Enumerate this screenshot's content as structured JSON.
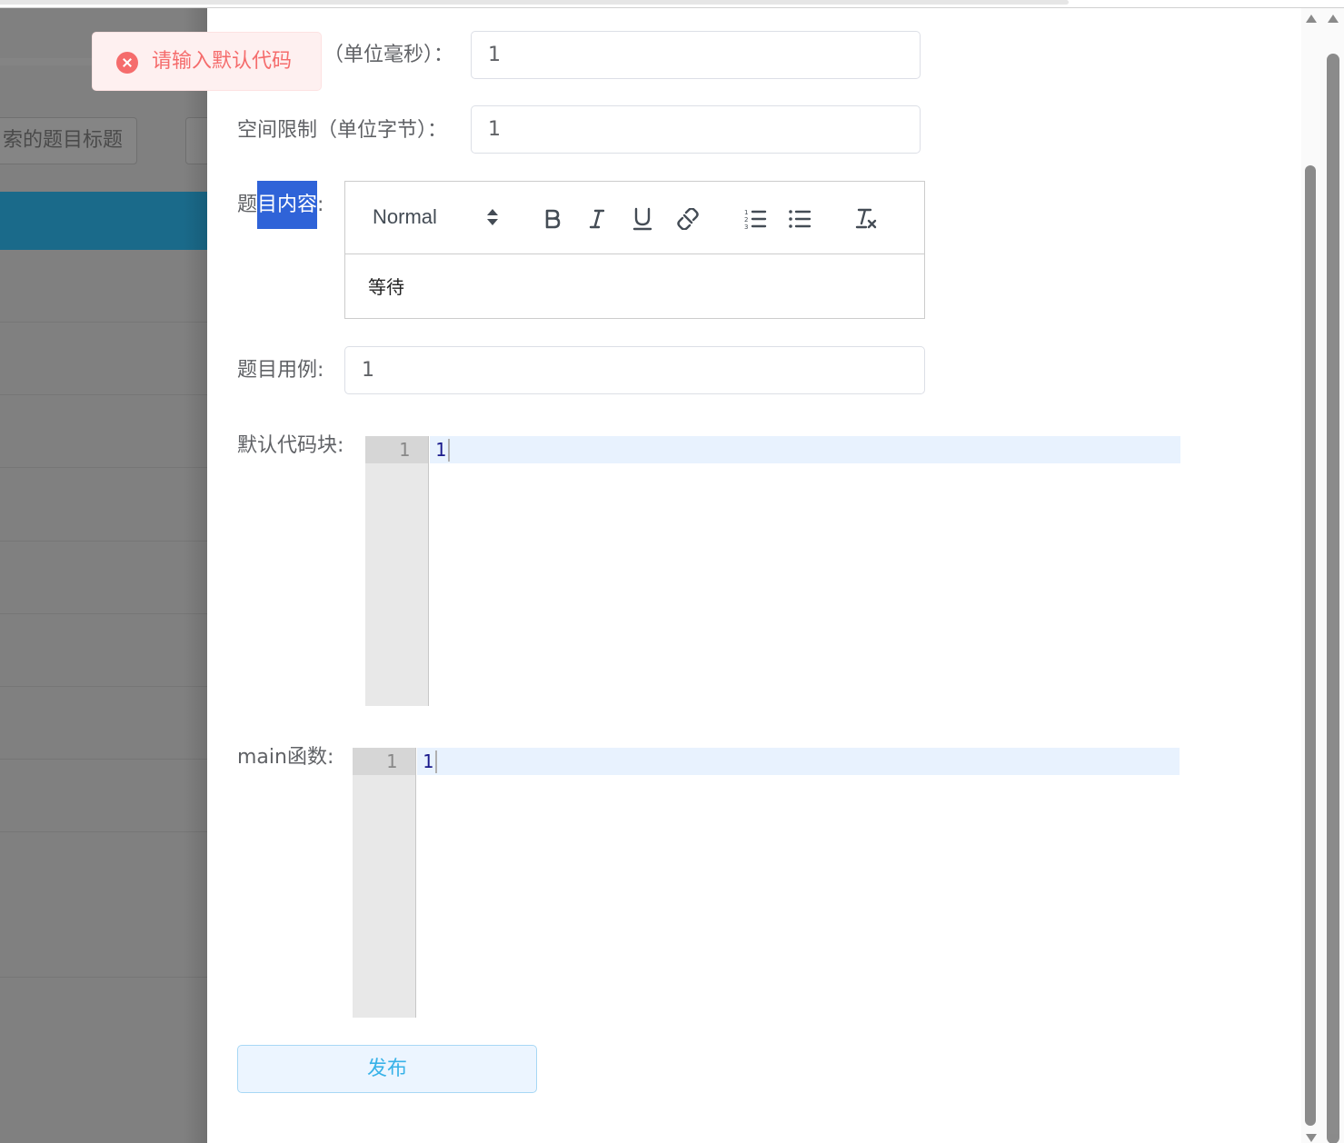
{
  "background": {
    "search_placeholder_fragment": "索的题目标题"
  },
  "form": {
    "time_limit_label_fragment": "（单位毫秒）：",
    "time_limit_value": "1",
    "space_limit_label": "空间限制（单位字节）：",
    "space_limit_value": "1",
    "content_label_prefix": "题",
    "content_label_selected": "目内容",
    "content_label_suffix": ":",
    "example_label": "题目用例:",
    "example_value": "1",
    "default_code_label": "默认代码块:",
    "main_label": "main函数:"
  },
  "editor": {
    "header_picker": "Normal",
    "body_text": "等待",
    "tools": [
      "bold-icon",
      "italic-icon",
      "underline-icon",
      "link-icon",
      "ordered-list-icon",
      "bullet-list-icon",
      "clear-format-icon"
    ]
  },
  "default_code": {
    "line_number": "1",
    "text": "1"
  },
  "main_code": {
    "line_number": "1",
    "text": "1"
  },
  "publish_label": "发布",
  "toast": {
    "type": "error",
    "message": "请输入默认代码"
  },
  "colors": {
    "error": "#f56c6c",
    "toast_bg": "#fef0f0",
    "selection": "#2f63d8",
    "publish_text": "#38b2e8",
    "table_header": "#1a6a8a"
  }
}
